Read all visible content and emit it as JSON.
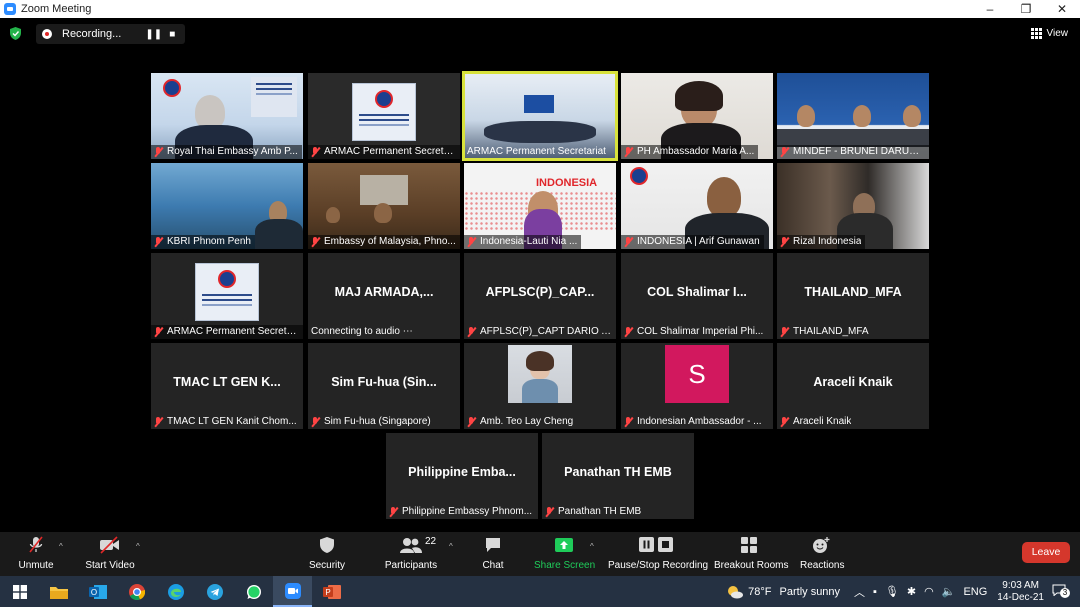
{
  "window": {
    "title": "Zoom Meeting",
    "controls": [
      "–",
      "❐",
      "✕"
    ]
  },
  "recording": {
    "label": "Recording...",
    "pause": "❚❚",
    "stop": "■"
  },
  "view_button": {
    "label": "View"
  },
  "tiles": [
    {
      "label": "Royal Thai Embassy Amb P...",
      "muted": true
    },
    {
      "label": "ARMAC Permanent Secreta...",
      "muted": true
    },
    {
      "label": "ARMAC Permanent Secretariat",
      "muted": false,
      "active": true
    },
    {
      "label": "PH Ambassador  Maria  A...",
      "muted": true
    },
    {
      "label": "MINDEF - BRUNEI DARUSS...",
      "muted": true
    },
    {
      "label": "KBRI Phnom Penh",
      "muted": true
    },
    {
      "label": "Embassy of Malaysia, Phno...",
      "muted": true
    },
    {
      "label": "Indonesia-Lauti Nia ...",
      "muted": true,
      "overlay_text": "INDONESIA"
    },
    {
      "label": "INDONESIA | Arif Gunawan",
      "muted": true
    },
    {
      "label": "Rizal Indonesia",
      "muted": true
    },
    {
      "label": "ARMAC Permanent Secreta...",
      "muted": true
    },
    {
      "label": "Connecting to audio ⋯",
      "muted": false,
      "name": "MAJ  ARMADA,..."
    },
    {
      "label": "AFPLSC(P)_CAPT DARIO A Y...",
      "muted": true,
      "name": "AFPLSC(P)_CAP..."
    },
    {
      "label": "COL Shalimar Imperial Phi...",
      "muted": true,
      "name": "COL  Shalimar  I..."
    },
    {
      "label": "THAILAND_MFA",
      "muted": true,
      "name": "THAILAND_MFA"
    },
    {
      "label": "TMAC LT GEN Kanit Chom...",
      "muted": true,
      "name": "TMAC LT GEN K..."
    },
    {
      "label": "Sim Fu-hua (Singapore)",
      "muted": true,
      "name": "Sim  Fu-hua  (Sin..."
    },
    {
      "label": "Amb. Teo Lay Cheng",
      "muted": true
    },
    {
      "label": "Indonesian Ambassador - ...",
      "muted": true,
      "avatar_letter": "S"
    },
    {
      "label": "Araceli Knaik",
      "muted": true,
      "name": "Araceli Knaik"
    },
    {
      "label": "Philippine Embassy Phnom...",
      "muted": true,
      "name": "Philippine  Emba..."
    },
    {
      "label": "Panathan TH EMB",
      "muted": true,
      "name": "Panathan TH EMB"
    }
  ],
  "toolbar": {
    "unmute": "Unmute",
    "start_video": "Start Video",
    "security": "Security",
    "participants": "Participants",
    "participants_count": "22",
    "chat": "Chat",
    "share_screen": "Share Screen",
    "pause_stop_recording": "Pause/Stop Recording",
    "breakout_rooms": "Breakout Rooms",
    "reactions": "Reactions",
    "leave": "Leave"
  },
  "taskbar": {
    "weather_temp": "78°F",
    "weather_text": "Partly sunny",
    "language": "ENG",
    "time": "9:03 AM",
    "date": "14-Dec-21",
    "notifications": "3"
  },
  "colors": {
    "active_speaker": "#d8e23c",
    "leave": "#d5372c",
    "share_green": "#1fcc5a",
    "avatar": "#d2185e"
  }
}
